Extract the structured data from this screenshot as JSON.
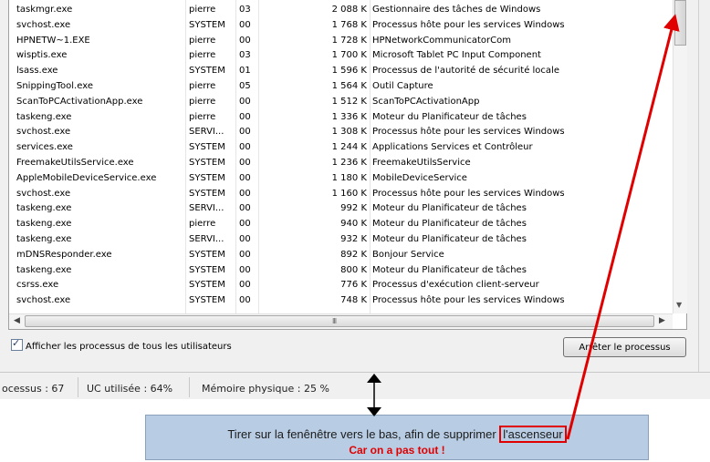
{
  "processes": [
    {
      "name": "taskmgr.exe",
      "user": "pierre",
      "cpu": "03",
      "mem": "2 088 K",
      "desc": "Gestionnaire des tâches de Windows"
    },
    {
      "name": "svchost.exe",
      "user": "SYSTEM",
      "cpu": "00",
      "mem": "1 768 K",
      "desc": "Processus hôte pour les services Windows"
    },
    {
      "name": "HPNETW~1.EXE",
      "user": "pierre",
      "cpu": "00",
      "mem": "1 728 K",
      "desc": "HPNetworkCommunicatorCom"
    },
    {
      "name": "wisptis.exe",
      "user": "pierre",
      "cpu": "03",
      "mem": "1 700 K",
      "desc": "Microsoft Tablet PC Input Component"
    },
    {
      "name": "lsass.exe",
      "user": "SYSTEM",
      "cpu": "01",
      "mem": "1 596 K",
      "desc": "Processus de l'autorité de sécurité locale"
    },
    {
      "name": "SnippingTool.exe",
      "user": "pierre",
      "cpu": "05",
      "mem": "1 564 K",
      "desc": "Outil Capture"
    },
    {
      "name": "ScanToPCActivationApp.exe",
      "user": "pierre",
      "cpu": "00",
      "mem": "1 512 K",
      "desc": "ScanToPCActivationApp"
    },
    {
      "name": "taskeng.exe",
      "user": "pierre",
      "cpu": "00",
      "mem": "1 336 K",
      "desc": "Moteur du Planificateur de tâches"
    },
    {
      "name": "svchost.exe",
      "user": "SERVI...",
      "cpu": "00",
      "mem": "1 308 K",
      "desc": "Processus hôte pour les services Windows"
    },
    {
      "name": "services.exe",
      "user": "SYSTEM",
      "cpu": "00",
      "mem": "1 244 K",
      "desc": "Applications Services et Contrôleur"
    },
    {
      "name": "FreemakeUtilsService.exe",
      "user": "SYSTEM",
      "cpu": "00",
      "mem": "1 236 K",
      "desc": "FreemakeUtilsService"
    },
    {
      "name": "AppleMobileDeviceService.exe",
      "user": "SYSTEM",
      "cpu": "00",
      "mem": "1 180 K",
      "desc": "MobileDeviceService"
    },
    {
      "name": "svchost.exe",
      "user": "SYSTEM",
      "cpu": "00",
      "mem": "1 160 K",
      "desc": "Processus hôte pour les services Windows"
    },
    {
      "name": "taskeng.exe",
      "user": "SERVI...",
      "cpu": "00",
      "mem": "992 K",
      "desc": "Moteur du Planificateur de tâches"
    },
    {
      "name": "taskeng.exe",
      "user": "pierre",
      "cpu": "00",
      "mem": "940 K",
      "desc": "Moteur du Planificateur de tâches"
    },
    {
      "name": "taskeng.exe",
      "user": "SERVI...",
      "cpu": "00",
      "mem": "932 K",
      "desc": "Moteur du Planificateur de tâches"
    },
    {
      "name": "mDNSResponder.exe",
      "user": "SYSTEM",
      "cpu": "00",
      "mem": "892 K",
      "desc": "Bonjour Service"
    },
    {
      "name": "taskeng.exe",
      "user": "SYSTEM",
      "cpu": "00",
      "mem": "800 K",
      "desc": "Moteur du Planificateur de tâches"
    },
    {
      "name": "csrss.exe",
      "user": "SYSTEM",
      "cpu": "00",
      "mem": "776 K",
      "desc": "Processus d'exécution client-serveur"
    },
    {
      "name": "svchost.exe",
      "user": "SYSTEM",
      "cpu": "00",
      "mem": "748 K",
      "desc": "Processus hôte pour les services Windows"
    }
  ],
  "show_all_users": {
    "label": "Afficher les processus de tous les utilisateurs",
    "checked": true
  },
  "end_process_button": "Arrêter le processus",
  "statusbar": {
    "processes": "ocessus : 67",
    "cpu": "UC utilisée : 64%",
    "memory": "Mémoire physique : 25 %"
  },
  "icons": {
    "hscroll_grip": "III"
  },
  "annotation": {
    "line1_prefix": "Tirer sur la fenênêtre vers le bas, afin de supprimer ",
    "line1_highlight": "l'ascenseur",
    "line2": "Car on a pas tout !",
    "highlight_color": "#e00000"
  }
}
